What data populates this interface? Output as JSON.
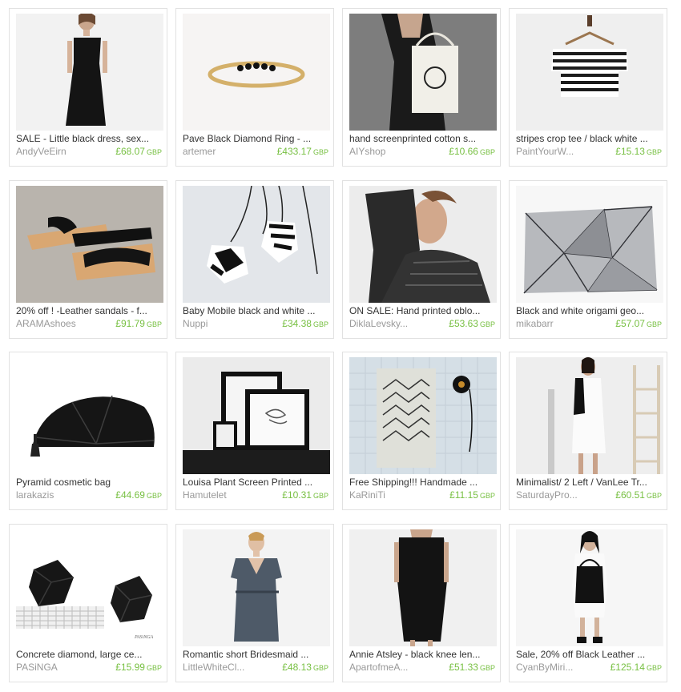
{
  "listings": [
    {
      "title": "SALE - Little black dress, sex...",
      "shop": "AndyVeEirn",
      "price": "£68.07",
      "currency": "GBP",
      "image": "woman-little-black-dress"
    },
    {
      "title": "Pave Black Diamond Ring - ...",
      "shop": "artemer",
      "price": "£433.17",
      "currency": "GBP",
      "image": "gold-ring-black-diamonds"
    },
    {
      "title": "hand screenprinted cotton s...",
      "shop": "AIYshop",
      "price": "£10.66",
      "currency": "GBP",
      "image": "cotton-tote-bag"
    },
    {
      "title": "stripes crop tee / black white ...",
      "shop": "PaintYourW...",
      "price": "£15.13",
      "currency": "GBP",
      "image": "striped-crop-tee-on-hanger"
    },
    {
      "title": "20% off ! -Leather sandals - f...",
      "shop": "ARAMAshoes",
      "price": "£91.79",
      "currency": "GBP",
      "image": "black-leather-sandals"
    },
    {
      "title": "Baby Mobile black and white ...",
      "shop": "Nuppi",
      "price": "£34.38",
      "currency": "GBP",
      "image": "paper-baby-mobile"
    },
    {
      "title": "ON SALE: Hand printed oblo...",
      "shop": "DiklaLevsky...",
      "price": "£53.63",
      "currency": "GBP",
      "image": "woman-printed-scarf"
    },
    {
      "title": "Black and white origami geo...",
      "shop": "mikabarr",
      "price": "£57.07",
      "currency": "GBP",
      "image": "origami-pillow"
    },
    {
      "title": "Pyramid cosmetic bag",
      "shop": "larakazis",
      "price": "£44.69",
      "currency": "GBP",
      "image": "black-pyramid-bag"
    },
    {
      "title": "Louisa Plant Screen Printed ...",
      "shop": "Hamutelet",
      "price": "£10.31",
      "currency": "GBP",
      "image": "framed-plant-prints"
    },
    {
      "title": "Free Shipping!!! Handmade ...",
      "shop": "KaRiniTi",
      "price": "£11.15",
      "currency": "GBP",
      "image": "geometric-notebook"
    },
    {
      "title": "Minimalist/ 2 Left / VanLee Tr...",
      "shop": "SaturdayPro...",
      "price": "£60.51",
      "currency": "GBP",
      "image": "woman-white-dress"
    },
    {
      "title": "Concrete diamond, large ce...",
      "shop": "PASiNGA",
      "price": "£15.99",
      "currency": "GBP",
      "image": "black-concrete-diamonds",
      "image_signature": "PASiNGA"
    },
    {
      "title": "Romantic short Bridesmaid ...",
      "shop": "LittleWhiteCl...",
      "price": "£48.13",
      "currency": "GBP",
      "image": "woman-grey-bridesmaid-dress"
    },
    {
      "title": "Annie Atsley - black knee len...",
      "shop": "ApartofmeA...",
      "price": "£51.33",
      "currency": "GBP",
      "image": "woman-black-knee-dress"
    },
    {
      "title": "Sale, 20% off Black Leather ...",
      "shop": "CyanByMiri...",
      "price": "£125.14",
      "currency": "GBP",
      "image": "woman-black-leather-backpack"
    }
  ]
}
